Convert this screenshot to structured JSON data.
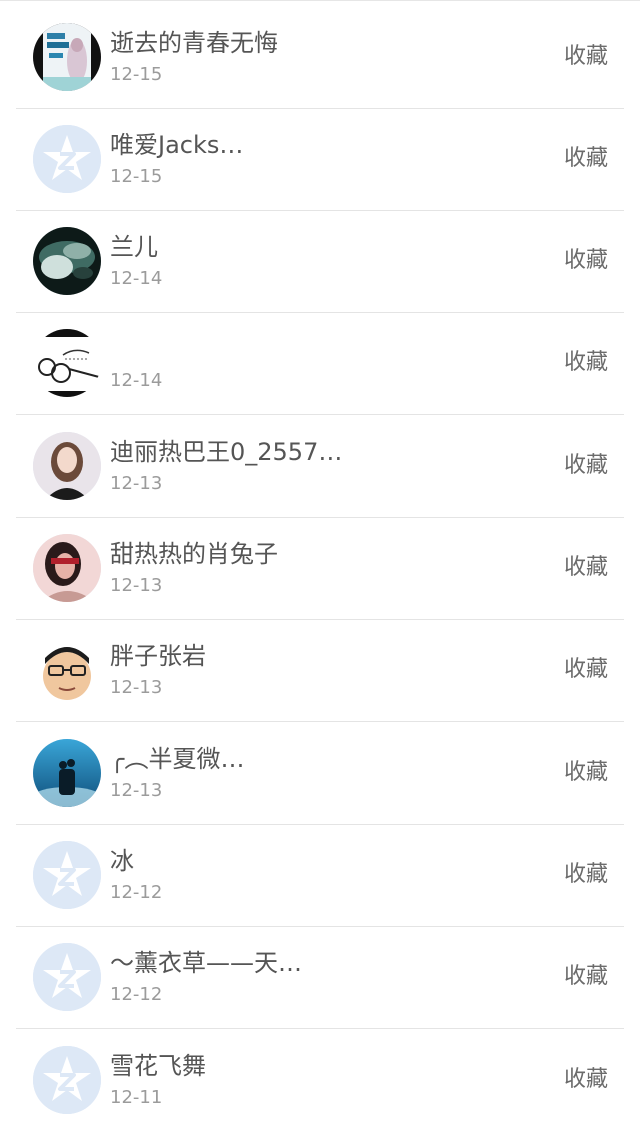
{
  "items": [
    {
      "name": "逝去的青春无悔",
      "date": "12-15",
      "action": "收藏",
      "avatar": "book-cover-avatar"
    },
    {
      "name": "唯爱Jacks…",
      "date": "12-15",
      "action": "收藏",
      "avatar": "default-qzone-avatar"
    },
    {
      "name": "兰儿",
      "date": "12-14",
      "action": "收藏",
      "avatar": "photo-avatar"
    },
    {
      "name": "",
      "date": "12-14",
      "action": "收藏",
      "avatar": "sketch-avatar"
    },
    {
      "name": "迪丽热巴王0_2557…",
      "date": "12-13",
      "action": "收藏",
      "avatar": "portrait-avatar"
    },
    {
      "name": "甜热热的肖兔子",
      "date": "12-13",
      "action": "收藏",
      "avatar": "portrait-avatar"
    },
    {
      "name": "胖子张岩",
      "date": "12-13",
      "action": "收藏",
      "avatar": "cartoon-face-avatar"
    },
    {
      "name": "╭︵半夏微…",
      "date": "12-13",
      "action": "收藏",
      "avatar": "couple-silhouette-avatar"
    },
    {
      "name": "冰",
      "date": "12-12",
      "action": "收藏",
      "avatar": "default-qzone-avatar"
    },
    {
      "name": "～薰衣草——天…",
      "date": "12-12",
      "action": "收藏",
      "avatar": "default-qzone-avatar"
    },
    {
      "name": "雪花飞舞",
      "date": "12-11",
      "action": "收藏",
      "avatar": "default-qzone-avatar"
    }
  ]
}
